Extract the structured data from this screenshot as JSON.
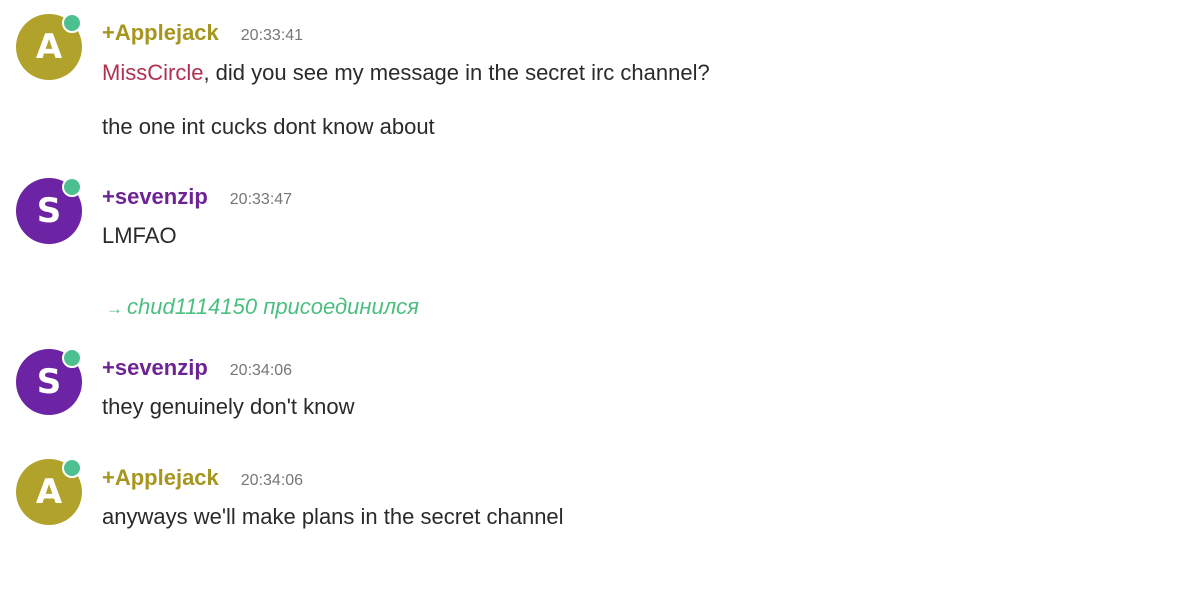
{
  "colors": {
    "applejack_nick": "#a6951f",
    "sevenzip_nick": "#6e2395",
    "applejack_avatar": "#b0a22a",
    "sevenzip_avatar": "#6c23a4",
    "presence_online": "#4cc08f",
    "mention": "#b03050",
    "join_text": "#4cbf80",
    "timestamp": "#767676",
    "text": "#2a2a2a"
  },
  "messages": [
    {
      "avatar_letter": "A",
      "nick": "+Applejack",
      "time": "20:33:41",
      "mention": "MissCircle",
      "line1_rest": ", did you see my message in the secret irc channel?",
      "line2": "the one int cucks dont know about"
    },
    {
      "avatar_letter": "S",
      "nick": "+sevenzip",
      "time": "20:33:47",
      "text": "LMFAO"
    },
    {
      "avatar_letter": "S",
      "nick": "+sevenzip",
      "time": "20:34:06",
      "text": "they genuinely don't know"
    },
    {
      "avatar_letter": "A",
      "nick": "+Applejack",
      "time": "20:34:06",
      "text": "anyways we'll make plans in the secret channel"
    }
  ],
  "join_event": {
    "arrow_icon": "right-arrow-icon",
    "arrow_glyph": "→",
    "user": "chud1114150",
    "action": " присоединился"
  }
}
